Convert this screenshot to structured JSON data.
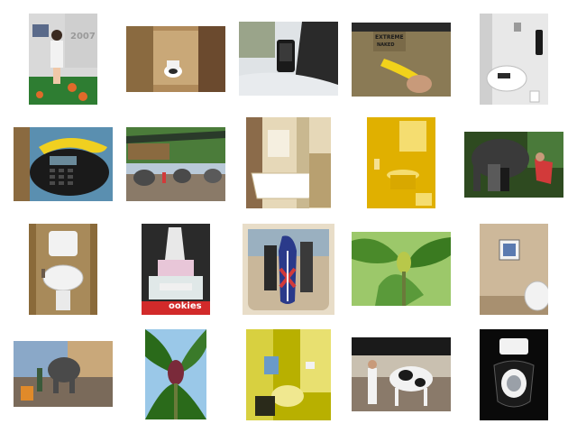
{
  "thumbnails": [
    {
      "name": "thumb-woman-exhibition",
      "caption_sign": "2007",
      "colors": [
        "#2e7d32",
        "#c8c8c8",
        "#e06a2a"
      ]
    },
    {
      "name": "thumb-toilet-stall-wood",
      "colors": [
        "#6b4a2e",
        "#b08a5a",
        "#ffffff"
      ]
    },
    {
      "name": "thumb-car-phone-mount",
      "colors": [
        "#2a2a2a",
        "#dfe3e6"
      ]
    },
    {
      "name": "thumb-banana-phone-shirt",
      "shirt_text_1": "EXTREME",
      "shirt_text_2": "NAKED",
      "colors": [
        "#8a7a55",
        "#f2d21b"
      ]
    },
    {
      "name": "thumb-toilet-wall-phone",
      "colors": [
        "#e8e8e8",
        "#1a1a1a"
      ]
    },
    {
      "name": "thumb-banana-conference-phone",
      "colors": [
        "#1a1a1a",
        "#f0d020",
        "#5a8fb0"
      ]
    },
    {
      "name": "thumb-elephants-park",
      "colors": [
        "#4b7c3a",
        "#b9c9d8",
        "#6a5a48"
      ]
    },
    {
      "name": "thumb-bathroom-tub",
      "colors": [
        "#e6d8b8",
        "#8b6b4a",
        "#ffffff"
      ]
    },
    {
      "name": "thumb-yellow-bathroom-sink",
      "colors": [
        "#e0b000",
        "#f5dd70"
      ]
    },
    {
      "name": "thumb-elephant-people",
      "colors": [
        "#2e4a20",
        "#3a3a3a",
        "#d23a3a"
      ]
    },
    {
      "name": "thumb-bidet-toilet",
      "colors": [
        "#8a6a3a",
        "#f2f2f2"
      ]
    },
    {
      "name": "thumb-toilet-cake",
      "sign_text": "ookies",
      "colors": [
        "#e8c6d8",
        "#d22a2a",
        "#2a2a2a"
      ]
    },
    {
      "name": "thumb-surfboard-beach",
      "colors": [
        "#c9b79a",
        "#2a3a8a",
        "#d23a3a"
      ]
    },
    {
      "name": "thumb-banana-tree",
      "colors": [
        "#4a8a2a",
        "#9cc86a"
      ]
    },
    {
      "name": "thumb-toilet-sign-wall",
      "colors": [
        "#cdb89a",
        "#f2f2f2"
      ]
    },
    {
      "name": "thumb-elephant-street",
      "colors": [
        "#7a6a5a",
        "#8aa8c8",
        "#e08a2a"
      ]
    },
    {
      "name": "thumb-banana-flower",
      "colors": [
        "#2a6a1a",
        "#7a2a3a",
        "#9ac8e8"
      ]
    },
    {
      "name": "thumb-yellow-toilet-room",
      "colors": [
        "#b8b000",
        "#e8e070"
      ]
    },
    {
      "name": "thumb-cow-show",
      "colors": [
        "#1a1a1a",
        "#f2f2f2",
        "#8a7a6a"
      ]
    },
    {
      "name": "thumb-dark-toilet",
      "colors": [
        "#0a0a0a",
        "#f2f2f2"
      ]
    }
  ]
}
